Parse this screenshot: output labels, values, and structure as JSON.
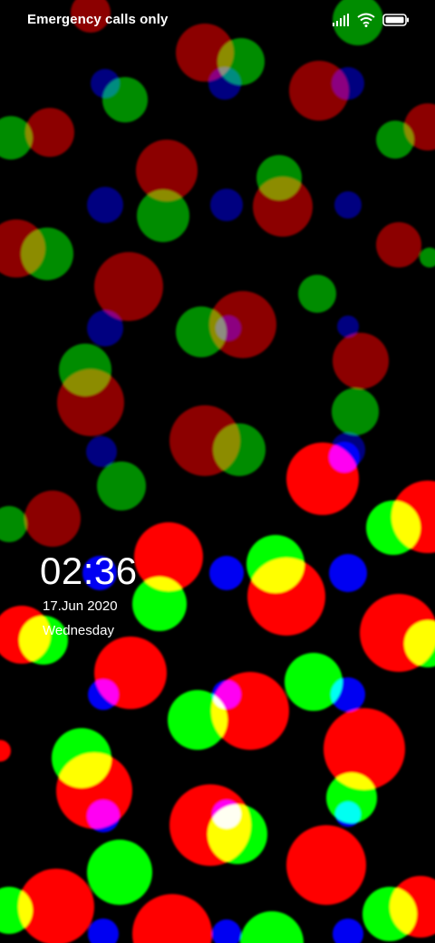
{
  "status_bar": {
    "carrier_text": "Emergency calls only",
    "signal_icon": "signal-bars-icon",
    "wifi_icon": "wifi-icon",
    "battery_icon": "battery-icon"
  },
  "lock_screen": {
    "time": "02:36",
    "date": "17.Jun 2020",
    "weekday": "Wednesday"
  },
  "wallpaper": {
    "name": "bokeh-dots-wallpaper",
    "colors": {
      "red": "#ff0000",
      "green": "#00ff00",
      "blue": "#0000ff",
      "background": "#000000"
    }
  }
}
